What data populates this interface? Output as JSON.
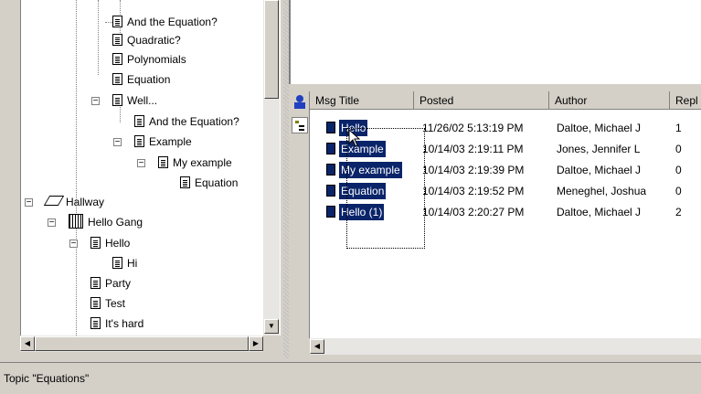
{
  "tree": {
    "nodes": [
      {
        "label": "And the Equation?",
        "type": "doc"
      },
      {
        "label": "Quadratic?",
        "type": "doc"
      },
      {
        "label": "Polynomials",
        "type": "doc"
      },
      {
        "label": "Equation",
        "type": "doc"
      },
      {
        "label": "Well...",
        "type": "doc"
      },
      {
        "label": "And the Equation?",
        "type": "doc"
      },
      {
        "label": "Example",
        "type": "doc"
      },
      {
        "label": "My example",
        "type": "doc"
      },
      {
        "label": "Equation",
        "type": "doc"
      },
      {
        "label": "Hallway",
        "type": "forum"
      },
      {
        "label": "Hello Gang",
        "type": "topic"
      },
      {
        "label": "Hello",
        "type": "doc"
      },
      {
        "label": "Hi",
        "type": "doc"
      },
      {
        "label": "Party",
        "type": "doc"
      },
      {
        "label": "Test",
        "type": "doc"
      },
      {
        "label": "It's hard",
        "type": "doc"
      }
    ]
  },
  "grid": {
    "columns": [
      "Msg Title",
      "Posted",
      "Author",
      "Repl"
    ],
    "rows": [
      {
        "title": "Hello",
        "posted": "11/26/02 5:13:19 PM",
        "author": "Daltoe, Michael J",
        "replies": "1"
      },
      {
        "title": "Example",
        "posted": "10/14/03 2:19:11 PM",
        "author": "Jones, Jennifer L",
        "replies": "0"
      },
      {
        "title": "My example",
        "posted": "10/14/03 2:19:39 PM",
        "author": "Daltoe, Michael J",
        "replies": "0"
      },
      {
        "title": "Equation",
        "posted": "10/14/03 2:19:52 PM",
        "author": "Meneghel, Joshua",
        "replies": "0"
      },
      {
        "title": "Hello (1)",
        "posted": "10/14/03 2:20:27 PM",
        "author": "Daltoe, Michael J",
        "replies": "2"
      }
    ]
  },
  "toolbar": {
    "icons": [
      "user-upload-icon",
      "tree-view-icon"
    ]
  },
  "status": {
    "text": "Topic \"Equations\""
  },
  "colors": {
    "selection": "#0a246a",
    "chrome": "#d4d0c8"
  }
}
